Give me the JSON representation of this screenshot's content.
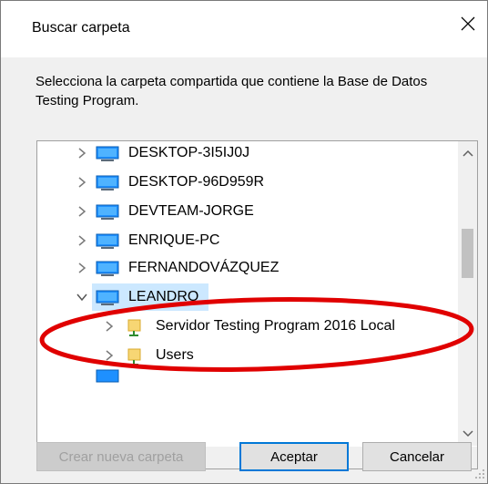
{
  "window": {
    "title": "Buscar carpeta",
    "close_label": "✕"
  },
  "instructions": "Selecciona la carpeta compartida que contiene la Base de Datos Testing Program.",
  "tree": {
    "items": [
      {
        "label": "DESKTOP-3I5IJ0J",
        "icon": "computer-icon",
        "expanded": false,
        "level": 0
      },
      {
        "label": "DESKTOP-96D959R",
        "icon": "computer-icon",
        "expanded": false,
        "level": 0
      },
      {
        "label": "DEVTEAM-JORGE",
        "icon": "computer-icon",
        "expanded": false,
        "level": 0
      },
      {
        "label": "ENRIQUE-PC",
        "icon": "computer-icon",
        "expanded": false,
        "level": 0
      },
      {
        "label": "FERNANDOVÁZQUEZ",
        "icon": "computer-icon",
        "expanded": false,
        "level": 0
      },
      {
        "label": "LEANDRO",
        "icon": "computer-icon",
        "expanded": true,
        "selected": true,
        "level": 0
      },
      {
        "label": "Servidor Testing Program 2016 Local",
        "icon": "shared-folder-icon",
        "expanded": false,
        "level": 1
      },
      {
        "label": "Users",
        "icon": "shared-folder-icon",
        "expanded": false,
        "level": 1
      }
    ]
  },
  "buttons": {
    "new_folder": "Crear nueva carpeta",
    "accept": "Aceptar",
    "cancel": "Cancelar"
  },
  "colors": {
    "selection": "#cce8ff",
    "highlight_oval": "#e00000",
    "default_button_border": "#0078d7"
  }
}
